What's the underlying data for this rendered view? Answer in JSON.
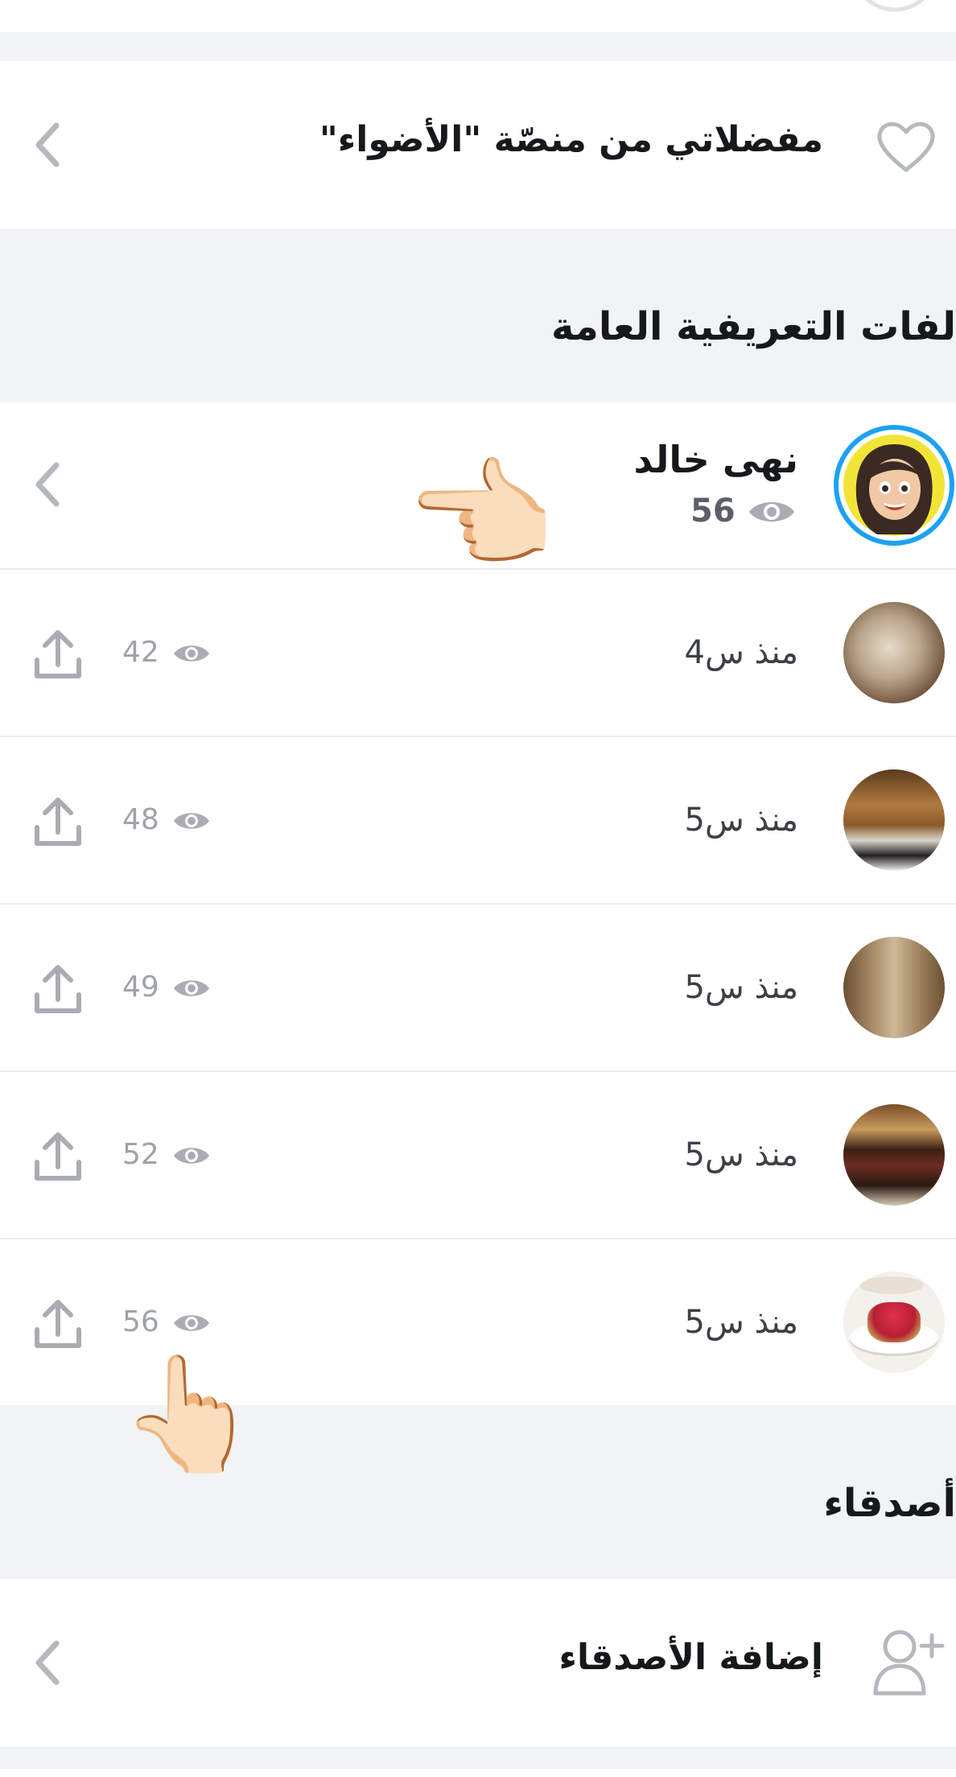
{
  "favorites": {
    "label": "مفضلاتي من منصّة \"الأضواء\"",
    "icon": "heart-icon"
  },
  "public_profiles": {
    "heading": "لفات التعريفية العامة"
  },
  "profile": {
    "name": "نهى خالد",
    "views": "56",
    "icon": "eye-icon"
  },
  "stories": [
    {
      "time": "منذ س4",
      "views": "42"
    },
    {
      "time": "منذ س5",
      "views": "48"
    },
    {
      "time": "منذ س5",
      "views": "49"
    },
    {
      "time": "منذ س5",
      "views": "52"
    },
    {
      "time": "منذ س5",
      "views": "56"
    }
  ],
  "friends": {
    "heading": "أصدقاء",
    "add_label": "إضافة الأصدقاء",
    "icon": "add-friend-icon"
  },
  "overlay": {
    "pointer_left": "👉🏻",
    "pointer_up": "👆🏻"
  },
  "colors": {
    "accent_ring": "#1da1f2",
    "chevron": "#b5b9bf",
    "muted": "#9ea3aa"
  }
}
